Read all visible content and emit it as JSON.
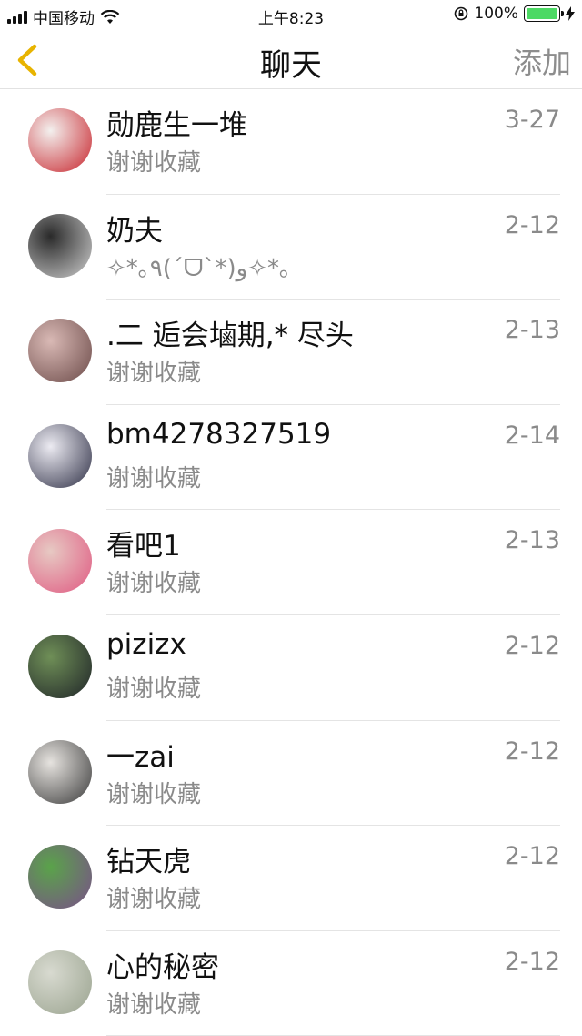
{
  "status_bar": {
    "carrier": "中国移动",
    "time": "上午8:23",
    "battery_percent": "100%",
    "battery_level": 1.0,
    "battery_color": "#4cd964"
  },
  "nav": {
    "back_icon": "chevron-left-icon",
    "back_color": "#e8b400",
    "title": "聊天",
    "add_label": "添加"
  },
  "chats": [
    {
      "name": "勋鹿生一堆",
      "message": "谢谢收藏",
      "date": "3-27",
      "avatar_colors": [
        "#f3f0ee",
        "#c8262e"
      ]
    },
    {
      "name": "奶夫",
      "message": "✧*｡٩(ˊᗜˋ*)و✧*｡",
      "date": "2-12",
      "avatar_colors": [
        "#2a2a2a",
        "#cfcfcf"
      ]
    },
    {
      "name": ".二 逅会塷期,* 尽头",
      "message": "谢谢收藏",
      "date": "2-13",
      "avatar_colors": [
        "#d9b9b5",
        "#6b4a48"
      ]
    },
    {
      "name": "bm4278327519",
      "message": "谢谢收藏",
      "date": "2-14",
      "avatar_colors": [
        "#ecebf2",
        "#2f3046"
      ]
    },
    {
      "name": "看吧1",
      "message": "谢谢收藏",
      "date": "2-13",
      "avatar_colors": [
        "#e7c9c3",
        "#e05a82"
      ]
    },
    {
      "name": "pizizx",
      "message": "谢谢收藏",
      "date": "2-12",
      "avatar_colors": [
        "#6f8f57",
        "#1f2428"
      ]
    },
    {
      "name": "一zai",
      "message": "谢谢收藏",
      "date": "2-12",
      "avatar_colors": [
        "#e6e3df",
        "#3b3b3b"
      ]
    },
    {
      "name": "钻天虎",
      "message": "谢谢收藏",
      "date": "2-12",
      "avatar_colors": [
        "#5aa34a",
        "#7a4f8a"
      ]
    },
    {
      "name": "心的秘密",
      "message": "谢谢收藏",
      "date": "2-12",
      "avatar_colors": [
        "#d8dad0",
        "#9aa38f"
      ]
    }
  ]
}
